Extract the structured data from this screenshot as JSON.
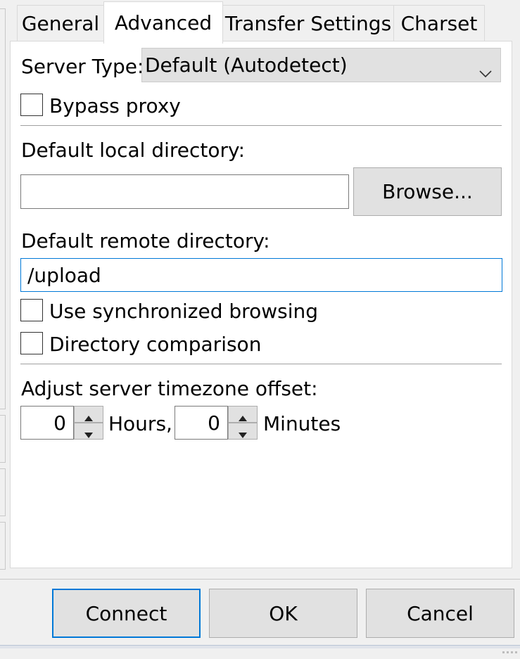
{
  "tabs": [
    {
      "label": "General"
    },
    {
      "label": "Advanced"
    },
    {
      "label": "Transfer Settings"
    },
    {
      "label": "Charset"
    }
  ],
  "advanced": {
    "server_type_label": "Server Type:",
    "server_type_value": "Default (Autodetect)",
    "bypass_proxy_label": "Bypass proxy",
    "bypass_proxy_checked": false,
    "local_dir_label": "Default local directory:",
    "local_dir_value": "",
    "browse_label": "Browse...",
    "remote_dir_label": "Default remote directory:",
    "remote_dir_value": "/upload",
    "sync_browsing_label": "Use synchronized browsing",
    "sync_browsing_checked": false,
    "dir_comparison_label": "Directory comparison",
    "dir_comparison_checked": false,
    "timezone_label": "Adjust server timezone offset:",
    "hours_value": "0",
    "hours_label": "Hours,",
    "minutes_value": "0",
    "minutes_label": "Minutes"
  },
  "buttons": {
    "connect": "Connect",
    "ok": "OK",
    "cancel": "Cancel"
  },
  "icons": [
    "chevron-down-icon",
    "spin-up-icon",
    "spin-down-icon"
  ],
  "colors": {
    "focus_accent": "#0078d7",
    "background": "#f0f0f0"
  }
}
